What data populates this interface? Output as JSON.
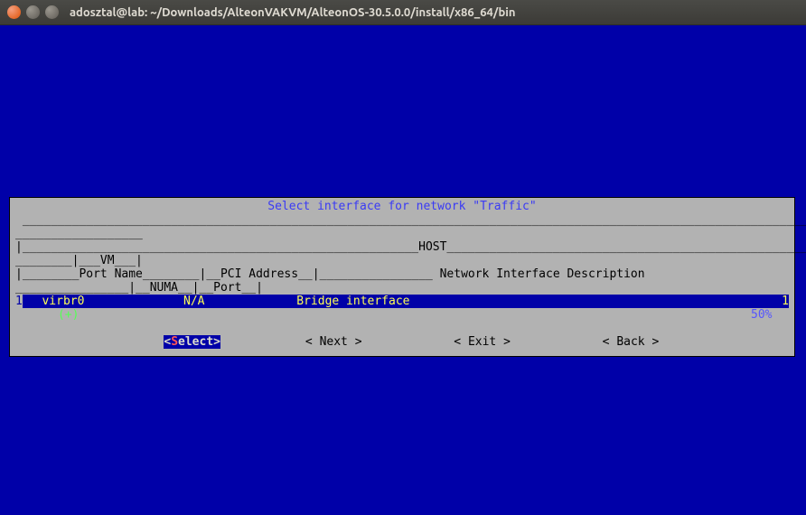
{
  "window": {
    "title": "adosztal@lab: ~/Downloads/AlteonVAKVM/AlteonOS-30.5.0.0/install/x86_64/bin"
  },
  "dialog": {
    "title": "Select interface for network \"Traffic\"",
    "header_top": " ____________________________________________________________________________________________________________________",
    "header_line1": "__________________  ",
    "header_line2": "|________________________________________________________HOST_____________________________________________________",
    "header_line3": "________|___VM___|  ",
    "header_line4": "|________Port Name________|__PCI Address__|________________ Network Interface Description ",
    "header_line5": "________________|__NUMA__|__Port__|",
    "row": {
      "index_left": "1",
      "port_name": "virbr0",
      "pci": "N/A",
      "desc": "Bridge interface",
      "index_right": "1"
    },
    "legend": {
      "plus": "(+)",
      "pct": "50%"
    },
    "buttons": {
      "select_open": "<",
      "select_hot": "S",
      "select_rest": "elect>",
      "next": "< Next >",
      "exit": "< Exit >",
      "back": "< Back >"
    }
  }
}
